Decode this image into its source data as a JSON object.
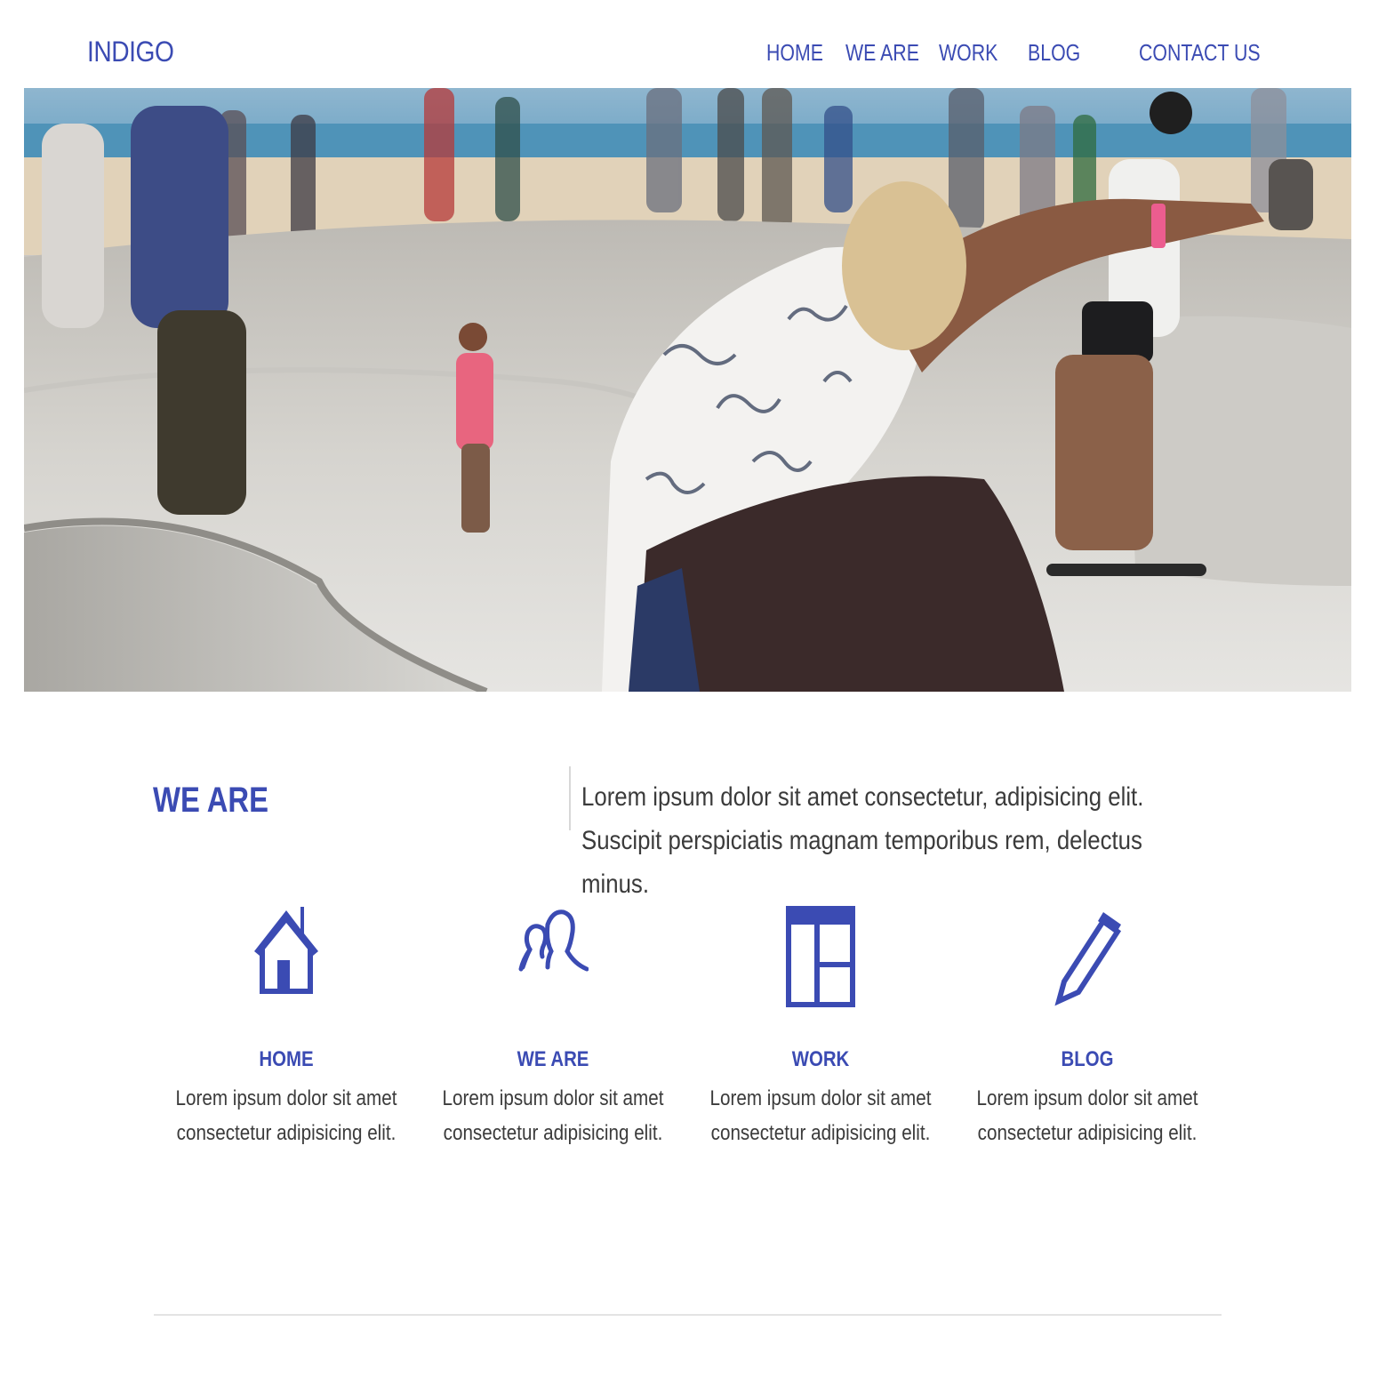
{
  "brand": {
    "logo": "INDIGO",
    "accent_color": "#3b4bb3"
  },
  "nav": {
    "home": "HOME",
    "we_are": "WE ARE",
    "work": "WORK",
    "blog": "BLOG",
    "contact": "CONTACT US"
  },
  "hero": {
    "image": "skatepark-photo"
  },
  "about": {
    "title": "WE ARE",
    "text": "Lorem ipsum dolor sit amet consectetur, adipisicing elit. Suscipit perspiciatis magnam temporibus rem, delectus minus."
  },
  "features": [
    {
      "icon": "home-icon",
      "title": "HOME",
      "text": "Lorem ipsum dolor sit amet consectetur adipisicing elit."
    },
    {
      "icon": "people-icon",
      "title": "WE ARE",
      "text": "Lorem ipsum dolor sit amet consectetur adipisicing elit."
    },
    {
      "icon": "layout-icon",
      "title": "WORK",
      "text": "Lorem ipsum dolor sit amet consectetur adipisicing elit."
    },
    {
      "icon": "pencil-icon",
      "title": "BLOG",
      "text": "Lorem ipsum dolor sit amet consectetur adipisicing elit."
    }
  ]
}
